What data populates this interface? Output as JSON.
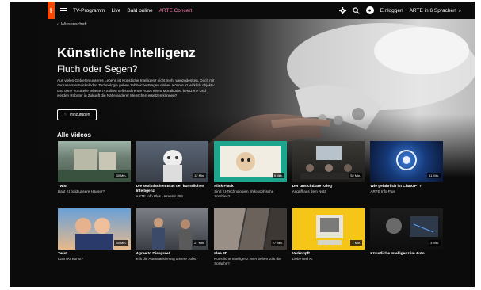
{
  "nav": {
    "logo": "arte",
    "items": [
      "TV-Programm",
      "Live",
      "Bald online",
      "ARTE Concert"
    ],
    "login": "Einloggen",
    "language": "ARTE in 6 Sprachen"
  },
  "breadcrumb": "Wissenschaft",
  "hero": {
    "title": "Künstliche Intelligenz",
    "subtitle": "Fluch oder Segen?",
    "description": "Aus vielen Gebieten unseres Lebens ist Künstliche Intelligenz nicht mehr wegzudenken. Doch mit der rasant entwickelnden Technologie gehen zahlreiche Fragen einher. Könnte KI wirklich objektiv und ohne Vorurteile arbeiten? Sollten selbstfahrende Autos einen Moralkodex besitzen? Und werden Roboter in Zukunft die Nähe anderer Menschen ersetzen können?",
    "add_label": "Hinzufügen"
  },
  "section_title": "Alle Videos",
  "row1": [
    {
      "title": "Twist",
      "sub": "Baut KI bald unsere Häuser?",
      "dur": "30 Min."
    },
    {
      "title": "Die sexistischen Bias der künstlichen Intelligenz",
      "sub": "ARTE Info Plus - Kreatur #5b",
      "dur": "12 Min."
    },
    {
      "title": "Flick Flack",
      "sub": "Sind KI-Technologien philosophische Zombies?",
      "dur": "6 Min."
    },
    {
      "title": "Der unsichtbare Krieg",
      "sub": "Angriff aus dem Netz",
      "dur": "52 Min."
    },
    {
      "title": "Wie gefährlich ist ChatGPT?",
      "sub": "ARTE Info Plus",
      "dur": "11 Min."
    }
  ],
  "row2": [
    {
      "title": "Twist",
      "sub": "Kann KI Kunst?",
      "dur": "30 Min."
    },
    {
      "title": "Agree to Disagree!",
      "sub": "Killt die Automatisierung unsere Jobs?",
      "dur": "27 Min."
    },
    {
      "title": "Idee 3D",
      "sub": "Künstliche Intelligenz: Wer beherrscht die Sprache?",
      "dur": "27 Min."
    },
    {
      "title": "Verknüpft",
      "sub": "Liebe und KI",
      "dur": "7 Min."
    },
    {
      "title": "Künstliche Intelligenz im Auto",
      "sub": "",
      "dur": "3 Min."
    }
  ]
}
